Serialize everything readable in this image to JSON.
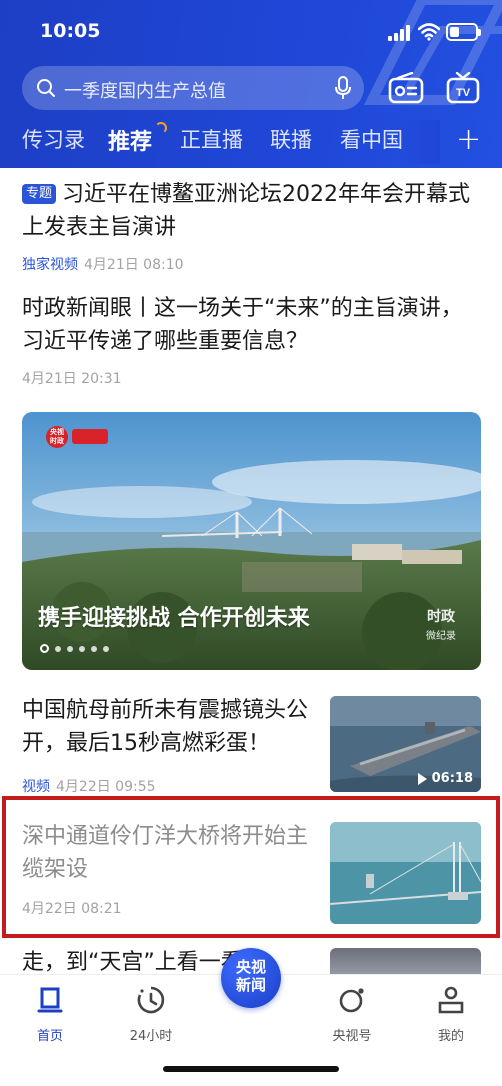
{
  "status_bar": {
    "time": "10:05"
  },
  "search": {
    "placeholder": "一季度国内生产总值"
  },
  "tabs": [
    {
      "label": "传习录"
    },
    {
      "label": "推荐",
      "active": true
    },
    {
      "label": "正直播"
    },
    {
      "label": "联播"
    },
    {
      "label": "看中国"
    }
  ],
  "feed": {
    "item1": {
      "badge": "专题",
      "title": "习近平在博鳌亚洲论坛2022年年会开幕式上发表主旨演讲",
      "source": "独家视频",
      "time": "4月21日 08:10"
    },
    "item2": {
      "title": "时政新闻眼丨这一场关于“未来”的主旨演讲，习近平传递了哪些重要信息？",
      "time": "4月21日 20:31"
    },
    "banner": {
      "caption": "携手迎接挑战 合作开创未来",
      "logo_text": "央视时政",
      "watermark": "时政微纪录",
      "slide_count": 6,
      "active_slide": 1
    },
    "item3": {
      "title": "中国航母前所未有震撼镜头公开，最后15秒高燃彩蛋！",
      "source": "视频",
      "time": "4月22日 09:55",
      "duration": "06:18"
    },
    "item4": {
      "title": "深中通道伶仃洋大桥将开始主缆架设",
      "time": "4月22日 08:21"
    },
    "item5": {
      "title": "走，到“天宫”上看一看！"
    }
  },
  "tabbar": {
    "home": "首页",
    "h24": "24小时",
    "center": "央视新闻",
    "channel": "央视号",
    "mine": "我的"
  },
  "colors": {
    "brand_blue": "#1f46d6",
    "highlight_red": "#c41b1b",
    "meta_gray": "#a3a3a3"
  }
}
